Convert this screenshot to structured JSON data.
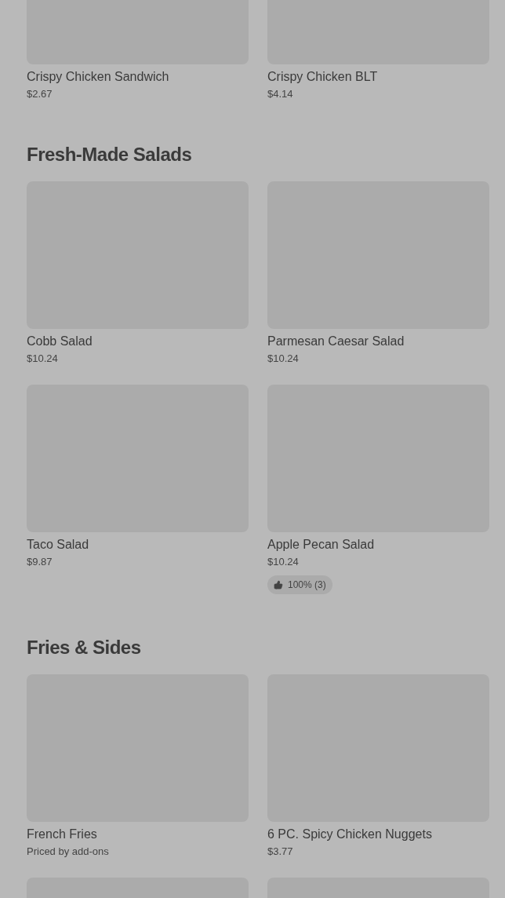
{
  "sections": [
    {
      "items": [
        {
          "kind": "product",
          "name": "Crispy Chicken Sandwich",
          "price": "$2.67"
        },
        {
          "kind": "product",
          "name": "Crispy Chicken BLT",
          "price": "$4.14"
        }
      ]
    },
    {
      "title": "Fresh-Made Salads",
      "items": [
        {
          "kind": "product",
          "name": "Cobb Salad",
          "price": "$10.24"
        },
        {
          "kind": "product",
          "name": "Parmesan Caesar Salad",
          "price": "$10.24"
        },
        {
          "kind": "product",
          "name": "Taco Salad",
          "price": "$9.87"
        },
        {
          "kind": "product",
          "name": "Apple Pecan Salad",
          "price": "$10.24",
          "rating": "100% (3)"
        }
      ]
    },
    {
      "title": "Fries & Sides",
      "items": [
        {
          "kind": "product",
          "name": "French Fries",
          "price": "Priced by add-ons"
        },
        {
          "kind": "product",
          "name": "6 PC. Spicy Chicken Nuggets",
          "price": "$3.77"
        },
        {
          "kind": "picture"
        },
        {
          "kind": "picture"
        }
      ]
    }
  ]
}
